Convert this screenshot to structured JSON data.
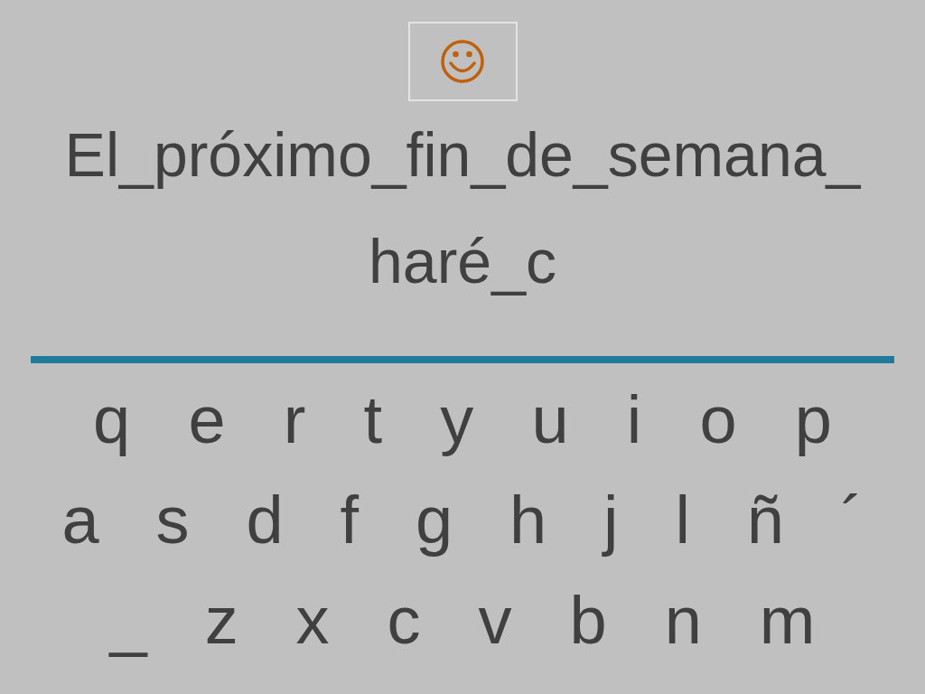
{
  "prompt_lines": [
    "El_próximo_fin_de_semana_",
    "haré_c"
  ],
  "keyboard_rows": [
    [
      "q",
      "e",
      "r",
      "t",
      "y",
      "u",
      "i",
      "o",
      "p"
    ],
    [
      "a",
      "s",
      "d",
      "f",
      "g",
      "h",
      "j",
      "l",
      "ñ",
      "´"
    ],
    [
      "_",
      "z",
      "x",
      "c",
      "v",
      "b",
      "n",
      "m"
    ]
  ]
}
